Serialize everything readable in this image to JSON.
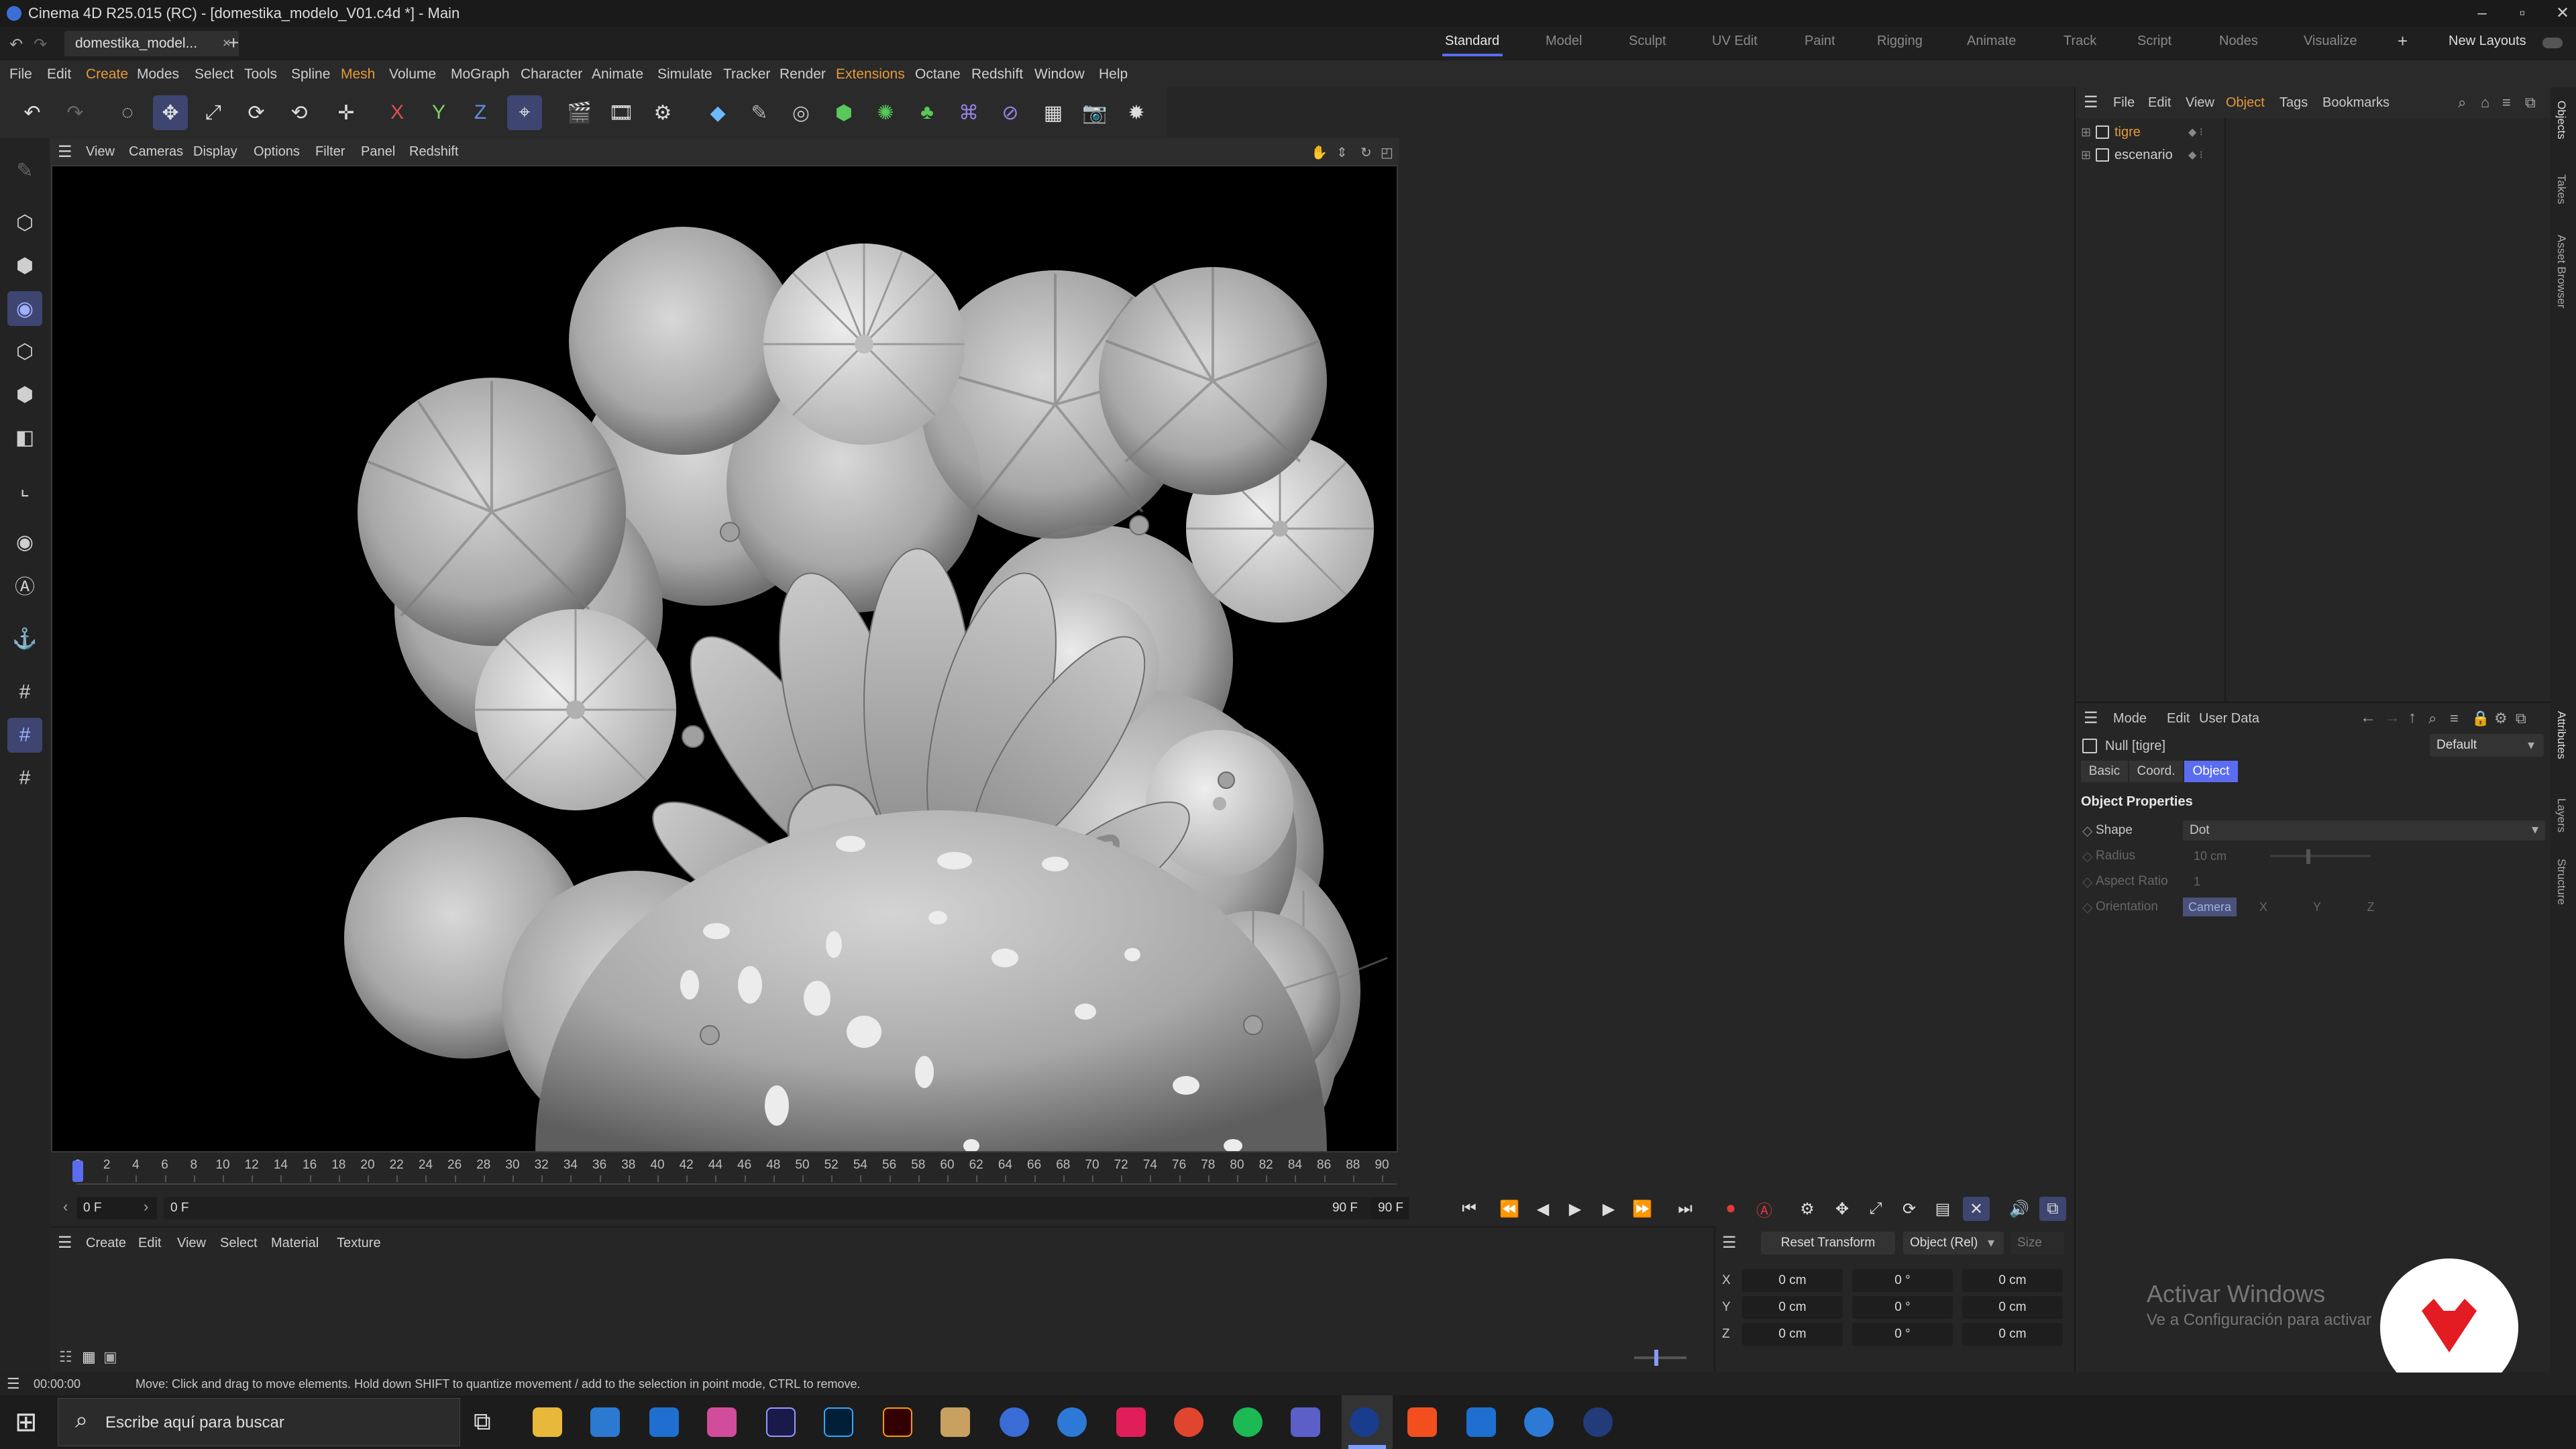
{
  "title_bar": {
    "text": "Cinema 4D R25.015 (RC) - [domestika_modelo_V01.c4d *] - Main",
    "minimize": "–",
    "maximize": "▫",
    "close": "✕"
  },
  "tabs": {
    "document_tab": "domestika_model...",
    "close": "×",
    "new_tab": "+",
    "layouts": [
      "Standard",
      "Model",
      "Sculpt",
      "UV Edit",
      "Paint",
      "Rigging",
      "Animate",
      "Track",
      "Script",
      "Nodes",
      "Visualize"
    ],
    "active_layout": "Standard",
    "add": "+",
    "new_layouts": "New Layouts"
  },
  "menu": [
    "File",
    "Edit",
    "Create",
    "Modes",
    "Select",
    "Tools",
    "Spline",
    "Mesh",
    "Volume",
    "MoGraph",
    "Character",
    "Animate",
    "Simulate",
    "Tracker",
    "Render",
    "Extensions",
    "Octane",
    "Redshift",
    "Window",
    "Help"
  ],
  "viewport_menu": [
    "View",
    "Cameras",
    "Display",
    "Options",
    "Filter",
    "Panel",
    "Redshift"
  ],
  "timeline": {
    "ticks": [
      "0",
      "2",
      "4",
      "6",
      "8",
      "10",
      "12",
      "14",
      "16",
      "18",
      "20",
      "22",
      "24",
      "26",
      "28",
      "30",
      "32",
      "34",
      "36",
      "38",
      "40",
      "42",
      "44",
      "46",
      "48",
      "50",
      "52",
      "54",
      "56",
      "58",
      "60",
      "62",
      "64",
      "66",
      "68",
      "70",
      "72",
      "74",
      "76",
      "78",
      "80",
      "82",
      "84",
      "86",
      "88",
      "90"
    ],
    "current_frame": "0 F",
    "preview_start": "0 F",
    "preview_end": "90 F",
    "end_frame": "90 F"
  },
  "material_menu": [
    "Create",
    "Edit",
    "View",
    "Select",
    "Material",
    "Texture"
  ],
  "coords": {
    "reset_transform": "Reset Transform",
    "mode": "Object (Rel)",
    "size": "Size",
    "rows": [
      {
        "axis": "X",
        "pos": "0 cm",
        "rot": "0 °",
        "size": "0 cm"
      },
      {
        "axis": "Y",
        "pos": "0 cm",
        "rot": "0 °",
        "size": "0 cm"
      },
      {
        "axis": "Z",
        "pos": "0 cm",
        "rot": "0 °",
        "size": "0 cm"
      }
    ]
  },
  "object_manager": {
    "menu": [
      "File",
      "Edit",
      "View",
      "Object",
      "Tags",
      "Bookmarks"
    ],
    "objects": [
      {
        "name": "tigre",
        "color": "#e59a3a"
      },
      {
        "name": "escenario",
        "color": "#cfcfcf"
      }
    ]
  },
  "attribute_manager": {
    "menu": [
      "Mode",
      "Edit",
      "User Data"
    ],
    "object_name": "Null [tigre]",
    "preset": "Default",
    "tabs": [
      "Basic",
      "Coord.",
      "Object"
    ],
    "active_tab": "Object",
    "section": "Object Properties",
    "shape_label": "Shape",
    "shape_value": "Dot",
    "radius_label": "Radius",
    "radius_value": "10 cm",
    "aspect_label": "Aspect Ratio",
    "aspect_value": "1",
    "orientation_label": "Orientation",
    "orientation_value": "Camera",
    "orient_axes": [
      "X",
      "Y",
      "Z"
    ]
  },
  "right_tabs": [
    "Objects",
    "Takes",
    "Asset Browser",
    "Attributes",
    "Layers",
    "Structure"
  ],
  "status": {
    "time": "00:00:00",
    "message": "Move: Click and drag to move elements. Hold down SHIFT to quantize movement / add to the selection in point mode, CTRL to remove."
  },
  "taskbar": {
    "search_placeholder": "Escribe aquí para buscar"
  },
  "watermark": {
    "line1": "Activar Windows",
    "line2": "Ve a Configuración para activar"
  },
  "colors": {
    "accent": "#5a6cf0",
    "highlight": "#e59a3a",
    "record": "#e03a3a",
    "logo_red": "#e31b23"
  }
}
